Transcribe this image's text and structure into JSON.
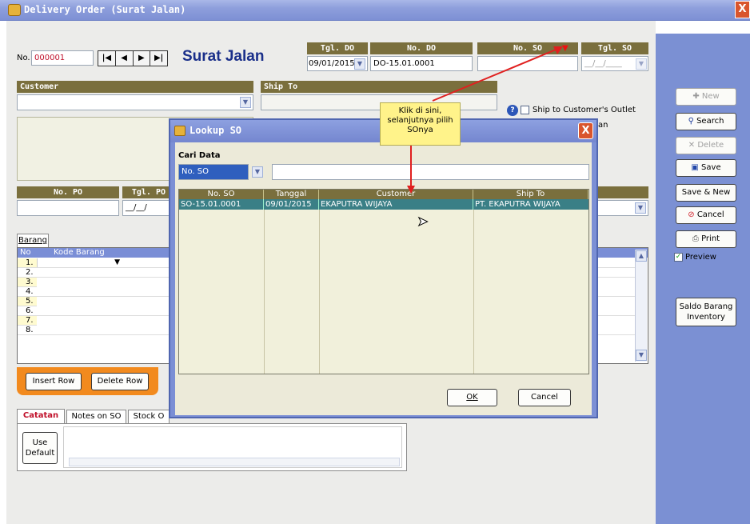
{
  "window": {
    "title": "Delivery Order (Surat Jalan)",
    "close_glyph": "X"
  },
  "header": {
    "no_label": "No.",
    "no_value": "000001",
    "title": "Surat Jalan",
    "tgl_do_label": "Tgl. DO",
    "tgl_do_value": "09/01/2015",
    "no_do_label": "No. DO",
    "no_do_value": "DO-15.01.0001",
    "no_so_label": "No. SO",
    "tgl_so_label": "Tgl. SO",
    "tgl_so_value": "__/__/____"
  },
  "nav": {
    "first": "|◀",
    "prev": "◀",
    "next": "▶",
    "last": "▶|"
  },
  "customer": {
    "label": "Customer",
    "value": ""
  },
  "ship_to": {
    "label": "Ship To",
    "value": ""
  },
  "ship_outlet": {
    "label": "Ship to Customer's Outlet",
    "help": "?"
  },
  "partial_label": "an",
  "po": {
    "label": "No. PO",
    "tgl_label": "Tgl. PO",
    "tgl_value": "__/__/"
  },
  "barang": {
    "tab": "Barang",
    "col_no": "No",
    "col_kode": "Kode Barang",
    "rows": [
      "1.",
      "2.",
      "3.",
      "4.",
      "5.",
      "6.",
      "7.",
      "8."
    ]
  },
  "row_buttons": {
    "insert": "Insert Row",
    "delete": "Delete Row"
  },
  "bottom_tabs": {
    "catatan": "Catatan",
    "notes_so": "Notes on SO",
    "stock": "Stock O",
    "use_default": "Use Default"
  },
  "tooltip": {
    "text": "Klik di sini, selanjutnya pilih SOnya"
  },
  "lookup": {
    "title": "Lookup SO",
    "cari_label": "Cari Data",
    "filter_value": "No. SO",
    "search_value": "",
    "columns": [
      "No. SO",
      "Tanggal",
      "Customer",
      "Ship To"
    ],
    "rows": [
      [
        "SO-15.01.0001",
        "09/01/2015",
        "EKAPUTRA WIJAYA",
        "PT. EKAPUTRA WIJAYA"
      ]
    ],
    "ok": "OK",
    "cancel": "Cancel"
  },
  "side": {
    "new": "New",
    "search": "Search",
    "delete": "Delete",
    "save": "Save",
    "save_new": "Save & New",
    "cancel": "Cancel",
    "print": "Print",
    "preview": "Preview",
    "saldo": "Saldo Barang Inventory"
  },
  "colors": {
    "header_brown": "#7a6f3d",
    "panel_blue": "#7b90d3",
    "accent_orange": "#f28a1e",
    "arrow_red": "#e0201f",
    "selected_row": "#3a7f86"
  }
}
